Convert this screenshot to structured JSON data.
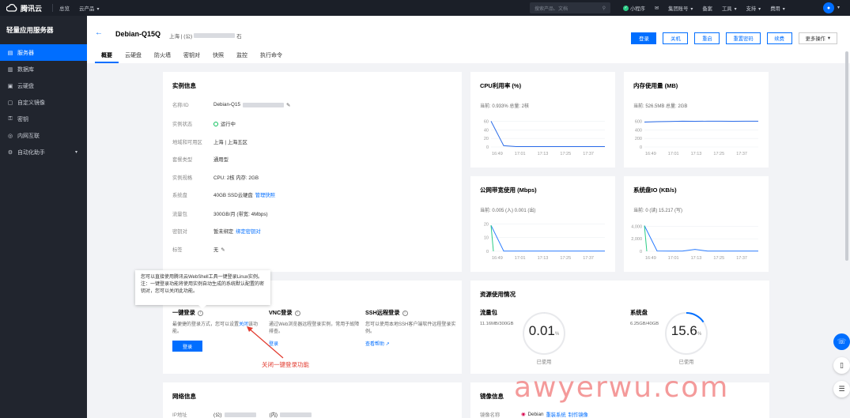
{
  "topbar": {
    "brand": "腾讯云",
    "overview": "总览",
    "products": "云产品",
    "search_placeholder": "搜索产品、文档",
    "mini_program": "小程序",
    "group_account": "集团账号",
    "filing": "备案",
    "tools": "工具",
    "support": "支持",
    "billing": "费用"
  },
  "sidebar": {
    "title": "轻量应用服务器",
    "items": [
      {
        "label": "服务器",
        "icon": "server-icon",
        "active": true
      },
      {
        "label": "数据库",
        "icon": "database-icon"
      },
      {
        "label": "云硬盘",
        "icon": "disk-icon"
      },
      {
        "label": "自定义镜像",
        "icon": "image-icon"
      },
      {
        "label": "密钥",
        "icon": "key-icon"
      },
      {
        "label": "内网互联",
        "icon": "network-icon"
      },
      {
        "label": "自动化助手",
        "icon": "automation-icon",
        "expandable": true
      }
    ]
  },
  "header": {
    "instance_name": "Debian-Q15Q",
    "ip_prefix": "上海 | (公)",
    "ip_suffix": "石",
    "actions": [
      "登录",
      "关机",
      "重启",
      "重置密码",
      "续费",
      "更多操作"
    ],
    "tabs": [
      "概要",
      "云硬盘",
      "防火墙",
      "密钥对",
      "快照",
      "监控",
      "执行命令"
    ]
  },
  "instance_info": {
    "title": "实例信息",
    "rows": [
      {
        "k": "名称/ID",
        "v": "Debian-Q15"
      },
      {
        "k": "实例状态",
        "v": "运行中"
      },
      {
        "k": "地域和可用区",
        "v": "上海 | 上海五区"
      },
      {
        "k": "套餐类型",
        "v": "通用型"
      },
      {
        "k": "实例规格",
        "v": "CPU: 2核 内存: 2GB"
      },
      {
        "k": "系统盘",
        "v": "40GB SSD云硬盘",
        "link": "管理快照"
      },
      {
        "k": "流量包",
        "v": "300GB/月 (带宽: 4Mbps)"
      },
      {
        "k": "密钥对",
        "v": "暂未绑定",
        "link": "绑定密钥对"
      },
      {
        "k": "标签",
        "v": "无"
      }
    ]
  },
  "charts": {
    "cpu": {
      "title": "CPU利用率 (%)",
      "summary": "当前: 0.933% 总量: 2核"
    },
    "mem": {
      "title": "内存使用量 (MB)",
      "summary": "当前: 526.5MB 总量: 2GB"
    },
    "net": {
      "title": "公网带宽使用 (Mbps)",
      "summary": "当前: 0.005 (入) 0.001 (出)"
    },
    "disk": {
      "title": "系统盘IO (KB/s)",
      "summary": "当前: 0 (读) 15.217 (写)"
    }
  },
  "chart_data": [
    {
      "type": "line",
      "title": "CPU利用率 (%)",
      "x": [
        "16:49",
        "17:01",
        "17:13",
        "17:25",
        "17:37"
      ],
      "yticks": [
        0,
        20,
        40,
        60
      ],
      "ylim": [
        0,
        70
      ],
      "series": [
        {
          "values": [
            60,
            3,
            1,
            1,
            1,
            1,
            1,
            1,
            1,
            1
          ]
        }
      ]
    },
    {
      "type": "line",
      "title": "内存使用量 (MB)",
      "x": [
        "16:49",
        "17:01",
        "17:13",
        "17:25",
        "17:37"
      ],
      "yticks": [
        0,
        200,
        400,
        600
      ],
      "ylim": [
        0,
        700
      ],
      "series": [
        {
          "values": [
            580,
            590,
            595,
            600,
            598,
            600,
            600,
            598,
            600,
            600
          ]
        }
      ]
    },
    {
      "type": "line",
      "title": "公网带宽使用 (Mbps)",
      "x": [
        "16:49",
        "17:01",
        "17:13",
        "17:25",
        "17:37"
      ],
      "yticks": [
        0,
        10,
        20
      ],
      "ylim": [
        0,
        22
      ],
      "series": [
        {
          "values": [
            19,
            0.2,
            0.1,
            0.1,
            0.1,
            0.1,
            0.1,
            0.1,
            0.1,
            0.1
          ]
        }
      ]
    },
    {
      "type": "line",
      "title": "系统盘IO (KB/s)",
      "x": [
        "16:49",
        "17:01",
        "17:13",
        "17:25",
        "17:37"
      ],
      "yticks": [
        0,
        2000,
        4000
      ],
      "ylim": [
        0,
        4800
      ],
      "series": [
        {
          "values": [
            4100,
            50,
            40,
            30,
            300,
            20,
            20,
            20,
            20,
            20
          ]
        }
      ]
    }
  ],
  "login": {
    "title": "一键登录",
    "desc": "最便捷的登录方式，您可以设置",
    "desc_link": "关闭",
    "desc_tail": "该功能。",
    "button": "登录",
    "vnc_title": "VNC登录",
    "vnc_desc": "通过Web浏览器远程登录实例，常用于故障排查。",
    "vnc_link": "登录",
    "ssh_title": "SSH远程登录",
    "ssh_desc": "您可以使用本地SSH客户端软件远程登录实例。",
    "ssh_link": "查看帮助",
    "tooltip": "您可以直接使用腾讯云WebShell工具一键登录Linux实例。注：一键登录功能将使用实例自动生成的系统默认配置的密钥对，您可以关闭此功能。",
    "annotation": "关闭一键登录功能"
  },
  "resources": {
    "title": "资源使用情况",
    "traffic_title": "流量包",
    "traffic_sub": "11.16MB/300GB",
    "traffic_value": "0.01",
    "traffic_fraction": 0.0001,
    "traffic_caption": "已使用",
    "disk_title": "系统盘",
    "disk_sub": "6.25GB/40GB",
    "disk_value": "15.6",
    "disk_fraction": 0.156,
    "disk_caption": "已使用",
    "percent": "%"
  },
  "network": {
    "title": "网络信息",
    "ip_label": "IP地址",
    "ip_public": "(公)",
    "ip_inner": "(内)"
  },
  "image": {
    "title": "镜像信息",
    "label": "镜像名称",
    "value": "Debian",
    "link1": "重装系统",
    "link2": "制作镜像"
  },
  "watermark": "awyerwu.com",
  "colors": {
    "accent": "#006eff",
    "ok": "#0abf5b",
    "annot": "#e23a2e"
  }
}
